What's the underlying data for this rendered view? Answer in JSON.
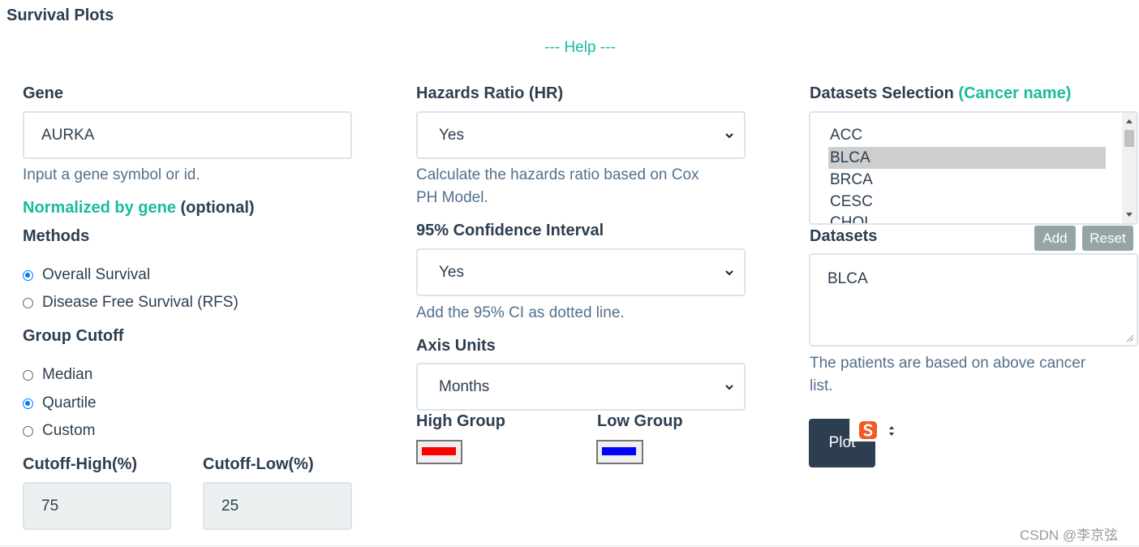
{
  "page": {
    "title": "Survival Plots",
    "help_link": "--- Help ---"
  },
  "gene": {
    "label": "Gene",
    "value": "AURKA",
    "hint": "Input a gene symbol or id.",
    "normalized_label": "Normalized by gene",
    "normalized_optional": "(optional)"
  },
  "methods": {
    "label": "Methods",
    "options": [
      {
        "label": "Overall Survival",
        "checked": true
      },
      {
        "label": "Disease Free Survival (RFS)",
        "checked": false
      }
    ]
  },
  "group_cutoff": {
    "label": "Group Cutoff",
    "options": [
      {
        "label": "Median",
        "checked": false
      },
      {
        "label": "Quartile",
        "checked": true
      },
      {
        "label": "Custom",
        "checked": false
      }
    ]
  },
  "cutoff_high": {
    "label": "Cutoff-High(%)",
    "value": "75"
  },
  "cutoff_low": {
    "label": "Cutoff-Low(%)",
    "value": "25"
  },
  "hazards": {
    "label": "Hazards Ratio (HR)",
    "value": "Yes",
    "hint_line1": "Calculate the hazards ratio based on Cox",
    "hint_line2": "PH Model."
  },
  "confidence": {
    "label": "95% Confidence Interval",
    "value": "Yes",
    "hint": "Add the 95% CI as dotted line."
  },
  "axis_units": {
    "label": "Axis Units",
    "value": "Months"
  },
  "high_group": {
    "label": "High Group",
    "color": "#ff0000"
  },
  "low_group": {
    "label": "Low Group",
    "color": "#0000ff"
  },
  "datasets_selection": {
    "label": "Datasets Selection",
    "label_accent": "(Cancer name)",
    "options": [
      "ACC",
      "BLCA",
      "BRCA",
      "CESC",
      "CHOL"
    ],
    "selected": "BLCA"
  },
  "datasets": {
    "label": "Datasets",
    "add_label": "Add",
    "reset_label": "Reset",
    "value": "BLCA",
    "hint_line1": "The patients are based on above cancer",
    "hint_line2": "list."
  },
  "plot_button": {
    "label": "Plot"
  },
  "watermark": "CSDN @李京弦",
  "colors": {
    "accent": "#18bc9c",
    "primary": "#2c3e50",
    "hint_text": "#54708c",
    "border": "#dce4ec",
    "secondary_button": "#95a5a6"
  }
}
